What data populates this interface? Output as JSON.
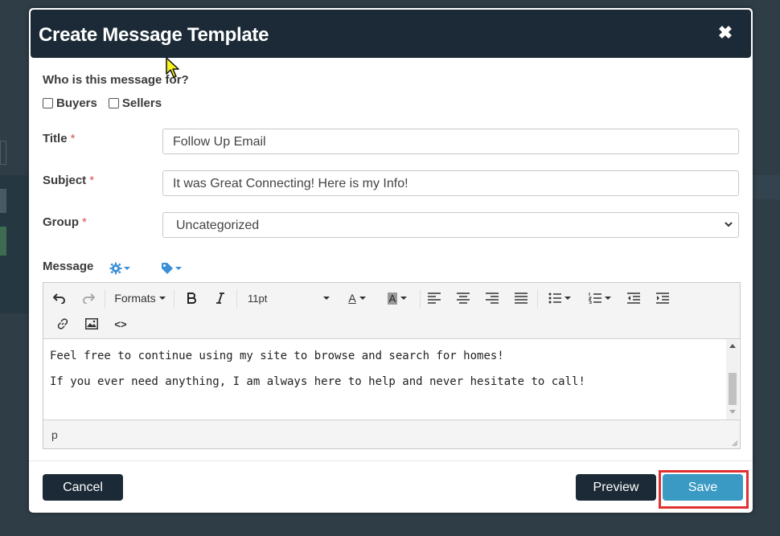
{
  "modal": {
    "title": "Create Message Template",
    "close_label": "✖"
  },
  "recipients": {
    "question": "Who is this message for?",
    "options": [
      {
        "label": "Buyers",
        "checked": false
      },
      {
        "label": "Sellers",
        "checked": false
      }
    ]
  },
  "fields": {
    "title_label": "Title",
    "title_value": "Follow Up Email",
    "subject_label": "Subject",
    "subject_value": "It was Great Connecting! Here is my Info!",
    "group_label": "Group",
    "group_value": "Uncategorized",
    "required_mark": "*",
    "message_label": "Message"
  },
  "editor": {
    "formats_label": "Formats",
    "font_size": "11pt",
    "text_color_glyph": "A",
    "bg_color_glyph": "A",
    "code_glyph": "<>",
    "paragraphs": [
      "Feel free to continue using my site to browse and search for homes!",
      "If you ever need anything, I am always here to help and never hesitate to call!"
    ],
    "status_path": "p"
  },
  "footer": {
    "cancel_label": "Cancel",
    "preview_label": "Preview",
    "save_label": "Save"
  },
  "colors": {
    "header_bg": "#1b2a36",
    "save_bg": "#3a9ac4",
    "accent_icon": "#3a8fd6",
    "highlight": "#e03131",
    "required": "#d9534f"
  }
}
